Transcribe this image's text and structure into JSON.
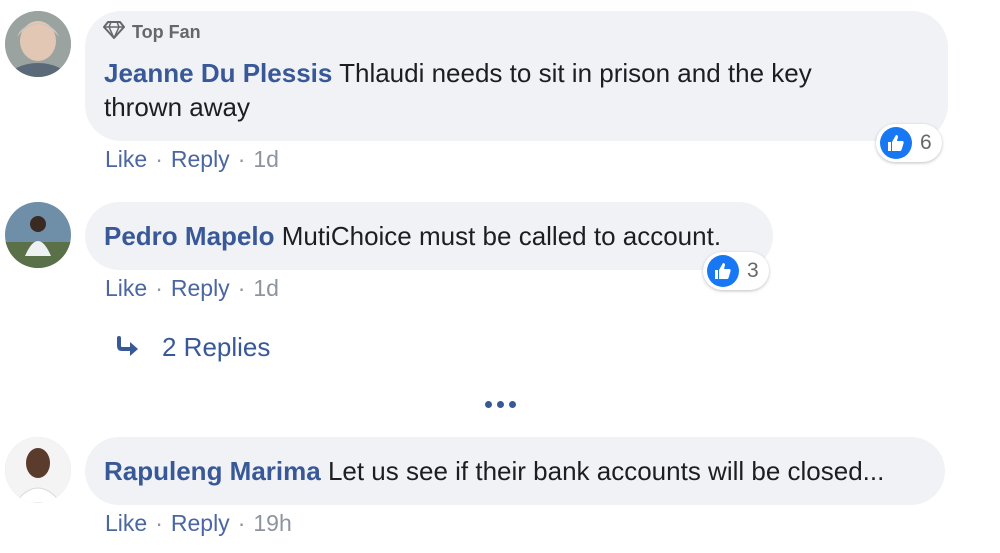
{
  "colors": {
    "link": "#385898",
    "like": "#1877f2",
    "bubble": "#f0f2f5",
    "meta": "#8d949e"
  },
  "comments": [
    {
      "badge": "Top Fan",
      "name": "Jeanne Du Plessis",
      "text": " Thlaudi needs to sit in prison and the key thrown away",
      "like_label": "Like",
      "reply_label": "Reply",
      "time": "1d",
      "reaction_count": "6"
    },
    {
      "name": "Pedro Mapelo",
      "text": " MutiChoice must be called to account.",
      "like_label": "Like",
      "reply_label": "Reply",
      "time": "1d",
      "reaction_count": "3",
      "replies_label": "2 Replies"
    },
    {
      "name": "Rapuleng Marima",
      "text": " Let us see if their bank accounts will be closed...",
      "like_label": "Like",
      "reply_label": "Reply",
      "time": "19h"
    }
  ],
  "icons": {
    "badge": "diamond-icon",
    "like": "thumbs-up-icon",
    "reply_arrow": "reply-arrow-icon",
    "more": "more-dots-icon"
  }
}
